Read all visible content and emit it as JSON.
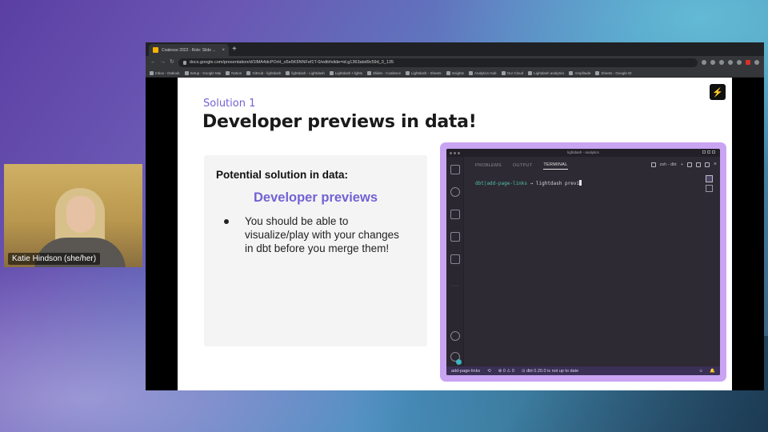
{
  "webcam": {
    "name_label": "Katie Hindson (she/her)"
  },
  "browser": {
    "tab_title": "Coalesce 2022 - Role: Slide ...",
    "tab_close": "×",
    "new_tab": "+",
    "url": "docs.google.com/presentation/d/1lMA4dcPOrH_o5e5K5NNFef1T-0/edit#slide=id.g1363abd9c59d_0_135",
    "bookmarks": [
      "Inbox - Outlook",
      "Setup - Google Mai",
      "Notion",
      "GitHub - lightdash",
      "lightdash - Lightdash",
      "Lightdash • lights",
      "Slides - Coalesce",
      "Lightdash - Sheets",
      "Insights",
      "Analytics Hub",
      "Our Cloud",
      "Lightdash analytics",
      "Amplitude",
      "Sheets - Google Dr"
    ]
  },
  "slide": {
    "subtitle": "Solution 1",
    "title": "Developer previews in data!",
    "logo_glyph": "⚡",
    "card": {
      "heading": "Potential solution in data:",
      "highlight": "Developer previews",
      "bullet": "You should be able to visualize/play with your changes in dbt before you merge them!"
    }
  },
  "vscode": {
    "window_title": "lightdash - analytics",
    "tabs": [
      "PROBLEMS",
      "OUTPUT",
      "TERMINAL"
    ],
    "active_tab": "TERMINAL",
    "terminal_name": "zsh - dbt",
    "plus": "+",
    "close": "×",
    "prompt_branch": "dbt|add-page-links",
    "prompt_arrow": "→",
    "command": "lightdash previ",
    "more_dots": "···",
    "status": {
      "branch": "add-page-links",
      "sync": "⟲",
      "problems": "⊗ 0 ⚠ 0",
      "dbt_status": "⊙ dbt 0.20.0 is not up to date",
      "bell": "🔔",
      "feedback": "☺"
    }
  }
}
